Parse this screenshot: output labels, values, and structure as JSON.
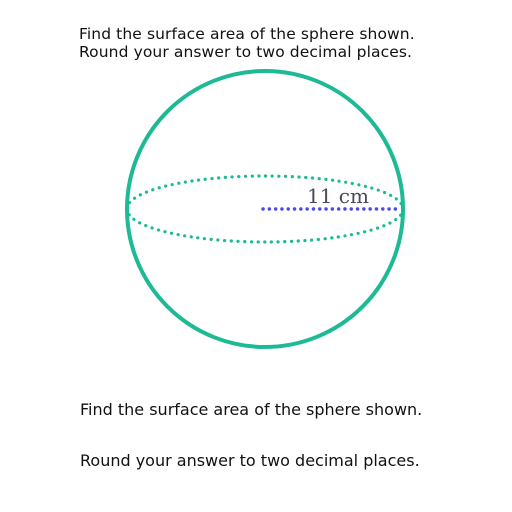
{
  "header": {
    "line1": "Find the surface area of the sphere shown.",
    "line2": "Round your answer to two decimal places."
  },
  "diagram": {
    "radius_label": "11 cm",
    "sphere_color": "#1dba95",
    "radius_color": "#4a4ae6",
    "label_color": "#4a4a5a"
  },
  "footer": {
    "line1": "Find the surface area of the sphere shown.",
    "line2": "Round your answer to two decimal places."
  }
}
